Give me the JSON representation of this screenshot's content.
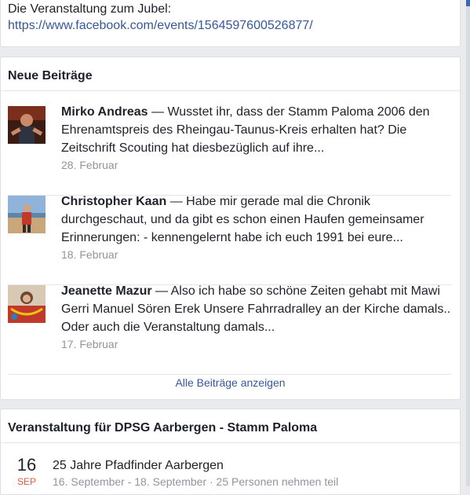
{
  "top_card": {
    "text": "Die Veranstaltung zum Jubel:",
    "link": "https://www.facebook.com/events/1564597600526877/"
  },
  "posts_card": {
    "title": "Neue Beiträge",
    "posts": [
      {
        "author": "Mirko Andreas",
        "text": "— Wusstet ihr, dass der Stamm Paloma 2006 den Ehrenamtspreis des Rheingau-Taunus-Kreis erhalten hat? Die Zeitschrift Scouting hat diesbezüglich auf ihre...",
        "date": "28. Februar"
      },
      {
        "author": "Christopher Kaan",
        "text": "— Habe mir gerade mal die Chronik durchgeschaut, und da gibt es schon einen Haufen gemeinsamer Erinnerungen: - kennengelernt habe ich euch 1991 bei eure...",
        "date": "18. Februar"
      },
      {
        "author": "Jeanette Mazur",
        "text": "— Also ich habe so schöne Zeiten gehabt mit Mawi Gerri Manuel Sören Erek Unsere Fahrradralley an der Kirche damals.. Oder auch die Veranstaltung damals...",
        "date": "17. Februar"
      }
    ],
    "see_all": "Alle Beiträge anzeigen"
  },
  "event_card": {
    "title": "Veranstaltung für DPSG Aarbergen - Stamm Paloma",
    "event": {
      "day": "16",
      "month": "SEP",
      "name": "25 Jahre Pfadfinder Aarbergen",
      "meta": "16. September - 18. September · 25 Personen nehmen teil"
    }
  },
  "colors": {
    "link": "#365899",
    "muted": "#90949c",
    "month": "#e9573f",
    "background": "#e9ebee"
  }
}
